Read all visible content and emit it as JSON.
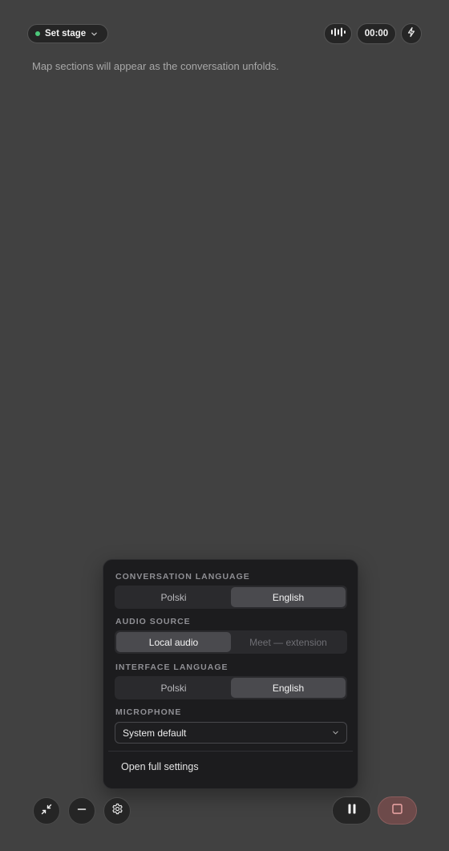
{
  "header": {
    "stage_label": "Set stage",
    "timer": "00:00",
    "status_color": "#4cc87a"
  },
  "hint": "Map sections will appear as the conversation unfolds.",
  "settings_panel": {
    "conversation_language": {
      "label": "CONVERSATION LANGUAGE",
      "options": [
        "Polski",
        "English"
      ],
      "selected": "English"
    },
    "audio_source": {
      "label": "AUDIO SOURCE",
      "options": [
        "Local audio",
        "Meet — extension"
      ],
      "selected": "Local audio"
    },
    "interface_language": {
      "label": "INTERFACE LANGUAGE",
      "options": [
        "Polski",
        "English"
      ],
      "selected": "English"
    },
    "microphone": {
      "label": "MICROPHONE",
      "value": "System default"
    },
    "open_full_settings": "Open full settings"
  },
  "icons": {
    "stage_chevron": "chevron-down-icon",
    "waveform": "waveform-icon",
    "flash": "flash-icon",
    "collapse": "collapse-icon",
    "minimize": "minimize-icon",
    "settings": "gear-icon",
    "pause": "pause-icon",
    "stop": "stop-icon"
  },
  "colors": {
    "background": "#414141",
    "panel": "#1c1c1e",
    "active_segment": "#4a4a4e",
    "stop_button": "#6d4a4a"
  }
}
